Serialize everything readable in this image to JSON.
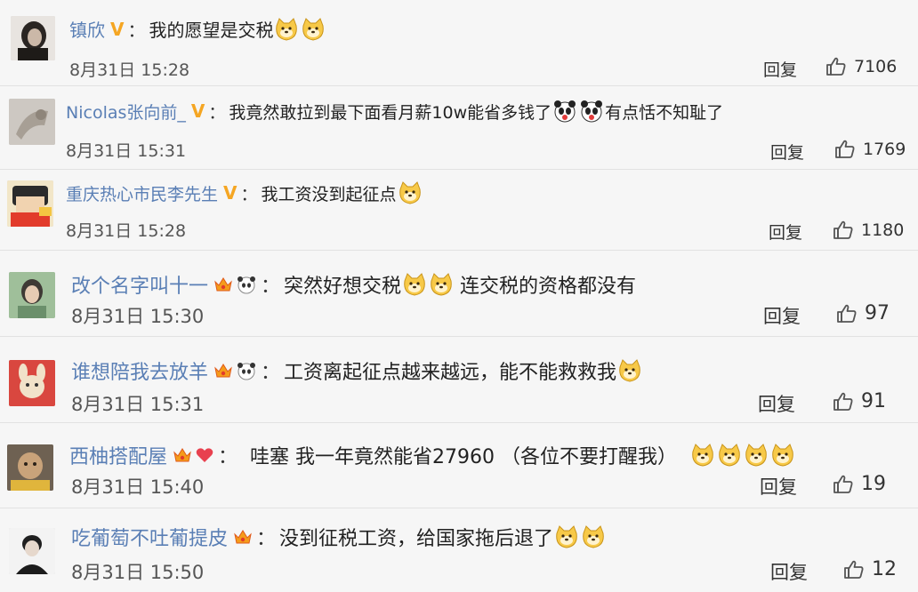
{
  "comments": [
    {
      "username": "镇欣",
      "badge": "V",
      "colon": "：",
      "text_before": "我的愿望是交税",
      "emojis_mid": 2,
      "text_after": "",
      "emojis_end": 0,
      "time": "8月31日 15:28",
      "reply_label": "回复",
      "likes": "7106"
    },
    {
      "username": "Nicolas张向前_",
      "badge": "V",
      "colon": "：",
      "text_before": "我竟然敢拉到最下面看月薪10w能省多钱了",
      "emojis_mid": 2,
      "text_after": "有点恬不知耻了",
      "emojis_end": 0,
      "time": "8月31日 15:31",
      "reply_label": "回复",
      "likes": "1769"
    },
    {
      "username": "重庆热心市民李先生",
      "badge": "V",
      "colon": "：",
      "text_before": "我工资没到起征点",
      "emojis_mid": 1,
      "text_after": "",
      "emojis_end": 0,
      "time": "8月31日 15:28",
      "reply_label": "回复",
      "likes": "1180"
    },
    {
      "username": "改个名字叫十一",
      "colon": "：",
      "text_before": "突然好想交税",
      "emojis_mid": 2,
      "text_after": "连交税的资格都没有",
      "emojis_end": 0,
      "time": "8月31日 15:30",
      "reply_label": "回复",
      "likes": "97"
    },
    {
      "username": "谁想陪我去放羊",
      "colon": "：",
      "text_before": "工资离起征点越来越远，能不能救救我",
      "emojis_mid": 1,
      "text_after": "",
      "emojis_end": 0,
      "time": "8月31日 15:31",
      "reply_label": "回复",
      "likes": "91"
    },
    {
      "username": "西柚搭配屋",
      "colon": "：",
      "text_before": "哇塞 我一年竟然能省27960 （各位不要打醒我）",
      "emojis_mid": 4,
      "text_after": "",
      "emojis_end": 0,
      "time": "8月31日 15:40",
      "reply_label": "回复",
      "likes": "19"
    },
    {
      "username": "吃葡萄不吐葡提皮",
      "colon": "：",
      "text_before": "没到征税工资，给国家拖后退了",
      "emojis_mid": 2,
      "text_after": "",
      "emojis_end": 0,
      "time": "8月31日 15:50",
      "reply_label": "回复",
      "likes": "12"
    }
  ],
  "colors": {
    "username": "#5a7fb5",
    "v_badge": "#f5a623",
    "background": "#f6f6f6",
    "divider": "#e2e2e2"
  },
  "icons": {
    "emoji": "doge-emoji-icon",
    "like": "thumbs-up-icon",
    "verified": "v-badge-icon",
    "crown": "crown-icon",
    "panda": "panda-icon",
    "heart": "heart-icon"
  }
}
